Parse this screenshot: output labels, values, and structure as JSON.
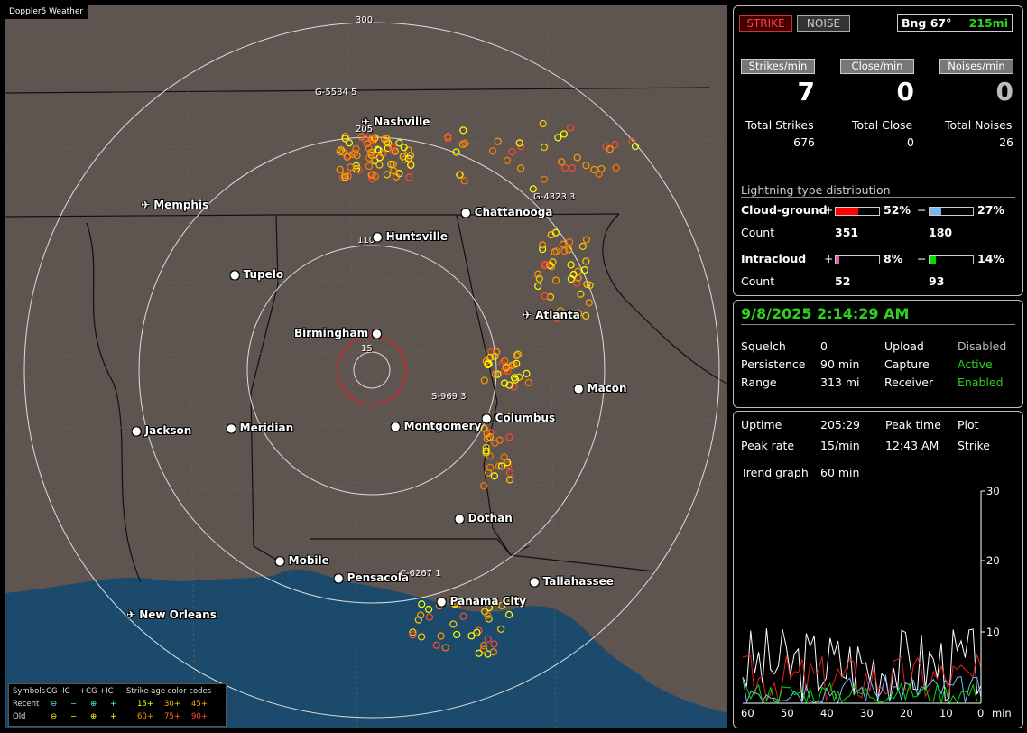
{
  "map": {
    "title": "Doppler5 Weather",
    "rings": [
      "300",
      "205",
      "110",
      "15"
    ],
    "cities": [
      "Nashville",
      "Memphis",
      "Chattanooga",
      "Huntsville",
      "Tupelo",
      "Atlanta",
      "Birmingham",
      "Macon",
      "Jackson",
      "Meridian",
      "Montgomery",
      "Columbus",
      "Dothan",
      "Mobile",
      "Pensacola",
      "Tallahassee",
      "Panama City",
      "New Orleans"
    ],
    "storms": [
      "G-5584",
      "5",
      "G-4323",
      "3",
      "S-969",
      "3",
      "C-6267",
      "1"
    ]
  },
  "legend": {
    "symbols_label": "Symbols",
    "cols": [
      "-CG",
      "-IC",
      "+CG",
      "+IC"
    ],
    "age_label": "Strike age color codes",
    "recent_label": "Recent",
    "old_label": "Old",
    "recent_ages": [
      "15+",
      "30+",
      "45+"
    ],
    "old_ages": [
      "60+",
      "75+",
      "90+"
    ]
  },
  "status": {
    "strike_btn": "STRIKE",
    "noise_btn": "NOISE",
    "bearing": "Bng 67°",
    "distance": "215mi",
    "strikes_rate_label": "Strikes/min",
    "close_rate_label": "Close/min",
    "noise_rate_label": "Noises/min",
    "strikes_rate": "7",
    "close_rate": "0",
    "noise_rate": "0",
    "total_strikes_label": "Total Strikes",
    "total_close_label": "Total Close",
    "total_noises_label": "Total Noises",
    "total_strikes": "676",
    "total_close": "0",
    "total_noises": "26"
  },
  "distribution": {
    "title": "Lightning type distribution",
    "cg_label": "Cloud-ground",
    "ic_label": "Intracloud",
    "count_label": "Count",
    "plus": "+",
    "minus": "−",
    "cg_pos_pct": "52%",
    "cg_neg_pct": "27%",
    "ic_pos_pct": "8%",
    "ic_neg_pct": "14%",
    "cg_pos_count": "351",
    "cg_neg_count": "180",
    "ic_pos_count": "52",
    "ic_neg_count": "93",
    "cg_pos_fraction": 0.52,
    "cg_neg_fraction": 0.27,
    "ic_pos_fraction": 0.08,
    "ic_neg_fraction": 0.14,
    "colors": {
      "cg_pos": "#ff0000",
      "cg_neg": "#7ab8f0",
      "ic_pos": "#e060b0",
      "ic_neg": "#00e000"
    }
  },
  "settings": {
    "datetime": "9/8/2025 2:14:29 AM",
    "squelch_label": "Squelch",
    "squelch": "0",
    "persistence_label": "Persistence",
    "persistence": "90 min",
    "range_label": "Range",
    "range": "313 mi",
    "upload_label": "Upload",
    "upload": "Disabled",
    "capture_label": "Capture",
    "capture": "Active",
    "receiver_label": "Receiver",
    "receiver": "Enabled"
  },
  "stats": {
    "uptime_label": "Uptime",
    "uptime": "205:29",
    "peak_time_label": "Peak time",
    "peak_time": "12:43 AM",
    "plot_label": "Plot",
    "plot": "Strike",
    "peak_rate_label": "Peak rate",
    "peak_rate": "15/min",
    "trend_label": "Trend graph",
    "trend": "60 min"
  },
  "trend_chart": {
    "y_ticks": [
      "30",
      "20",
      "10"
    ],
    "x_ticks": [
      "60",
      "50",
      "40",
      "30",
      "20",
      "10",
      "0"
    ],
    "x_unit": "min"
  }
}
